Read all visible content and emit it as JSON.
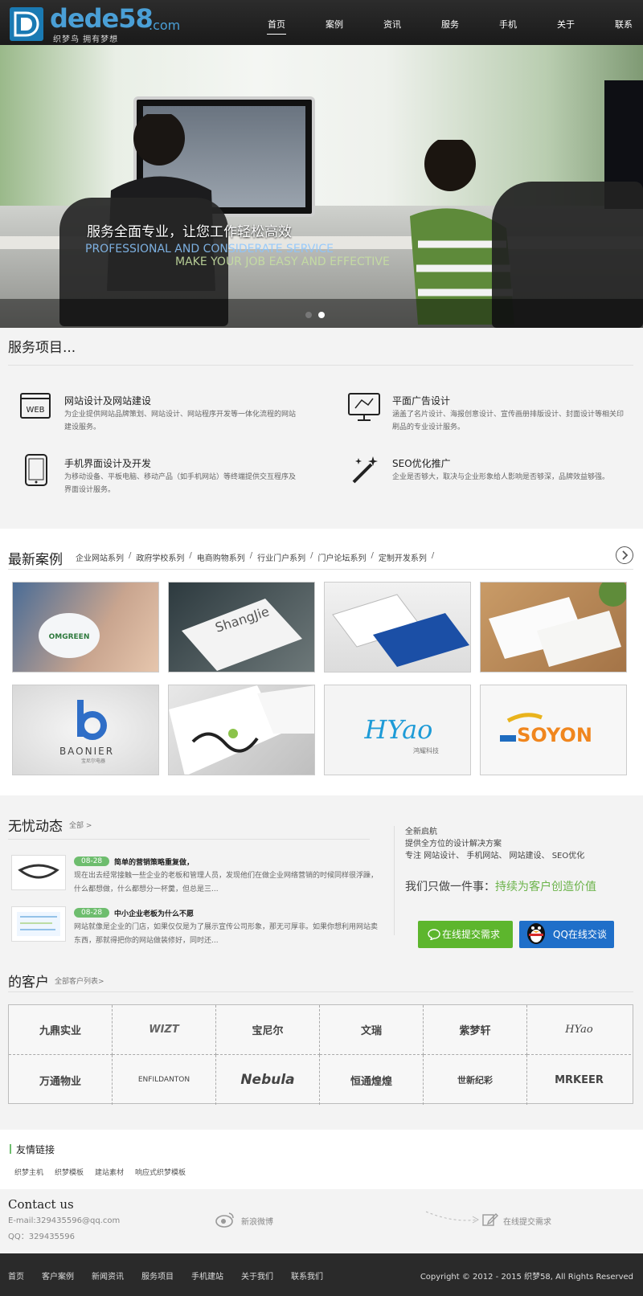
{
  "header": {
    "logo_word": "dede58",
    "logo_tld": ".com",
    "logo_slogan": "织梦鸟 拥有梦想",
    "nav": [
      "首页",
      "案例",
      "资讯",
      "服务",
      "手机",
      "关于",
      "联系"
    ],
    "active_nav": "首页"
  },
  "banner": {
    "title": "服务全面专业，让您工作轻松高效",
    "subtitle_en_1": "PROFESSIONAL AND CONSIDERATE SERVICE",
    "subtitle_en_2": "MAKE YOUR JOB EASY AND EFFECTIVE",
    "slide_count": 2,
    "active_slide": 2
  },
  "services": {
    "title": "服务项目...",
    "items": [
      {
        "icon": "web-icon",
        "icon_text": "WEB",
        "title": "网站设计及网站建设",
        "desc": "为企业提供网站品牌策划、网站设计、网站程序开发等一体化流程的网站建设服务。"
      },
      {
        "icon": "monitor-design-icon",
        "title": "平面广告设计",
        "desc": "涵盖了名片设计、海报创意设计、宣传画册排版设计、封面设计等相关印刷品的专业设计服务。"
      },
      {
        "icon": "tablet-icon",
        "title": "手机界面设计及开发",
        "desc": "为移动设备、平板电脑、移动产品（如手机网站）等终端提供交互程序及界面设计服务。"
      },
      {
        "icon": "magic-wand-icon",
        "title": "SEO优化推广",
        "desc": "企业是否够大，取决与企业形象给人影响是否够深，品牌效益够强。"
      }
    ]
  },
  "cases": {
    "title": "最新案例",
    "tabs": [
      "企业网站系列",
      "政府学校系列",
      "电商购物系列",
      "行业门户系列",
      "门户论坛系列",
      "定制开发系列"
    ],
    "thumbs": [
      {
        "name": "case-cup",
        "label": "OMGREEN"
      },
      {
        "name": "case-shangjie",
        "label": "ShangJie"
      },
      {
        "name": "case-blue-cards",
        "label": ""
      },
      {
        "name": "case-wood-cards",
        "label": ""
      },
      {
        "name": "case-baonier",
        "label": "BAONIER"
      },
      {
        "name": "case-calligraphy",
        "label": ""
      },
      {
        "name": "case-hyao",
        "label": "HYao"
      },
      {
        "name": "case-soyon",
        "label": "SOYON"
      }
    ],
    "thumb_subs": {
      "baonier": "宝尼尔电器",
      "hyao": "鸿耀科技"
    }
  },
  "news": {
    "title": "无忧动态",
    "more": "全部 >",
    "items": [
      {
        "date": "08-28",
        "title": "简单的营销策略重复做，",
        "excerpt": "现在出去经常接触一些企业的老板和管理人员，发现他们在做企业网络营销的时候同样很浮躁，什么都想做，什么都想分一杯羹，但总是三..."
      },
      {
        "date": "08-28",
        "title": "中小企业老板为什么不愿",
        "excerpt": "网站就像是企业的门店，如果仅仅是为了展示宣传公司形象，那无可厚非。如果你想利用网站卖东西，那就得把你的网站做装修好，同时还..."
      }
    ],
    "promo_lines": [
      "全新启航",
      "提供全方位的设计解决方案",
      "专注 网站设计、 手机网站、 网站建设、 SEO优化"
    ],
    "promo_big_prefix": "我们只做一件事：",
    "promo_big_highlight": "持续为客户创造价值",
    "btn_request": "在线提交需求",
    "btn_qq": "QQ在线交谈"
  },
  "clients": {
    "title": "的客户",
    "more": "全部客户列表>",
    "logos": [
      "九鼎实业",
      "WIZT",
      "宝尼尔",
      "文瑞",
      "紫梦轩",
      "HYao",
      "万通物业",
      "ENFILDANTON",
      "Nebula",
      "恒通煌煌",
      "世新纪彩",
      "MRKEER"
    ]
  },
  "links": {
    "title": "友情链接",
    "items": [
      "织梦主机",
      "织梦模板",
      "建站素材",
      "响应式织梦模板"
    ]
  },
  "contact": {
    "title": "Contact us",
    "email": "E-mail:329435596@qq.com",
    "qq": "QQ：329435596",
    "weibo": "新浪微博",
    "online": "在线提交需求"
  },
  "footer": {
    "nav": [
      "首页",
      "客户案例",
      "新闻资讯",
      "服务项目",
      "手机建站",
      "关于我们",
      "联系我们"
    ],
    "copyright": "Copyright © 2012 - 2015 织梦58, All Rights Reserved"
  },
  "colors": {
    "accent_green": "#6bb34a",
    "qq_blue": "#1f6fc9",
    "logo_blue": "#4a9fd6"
  }
}
